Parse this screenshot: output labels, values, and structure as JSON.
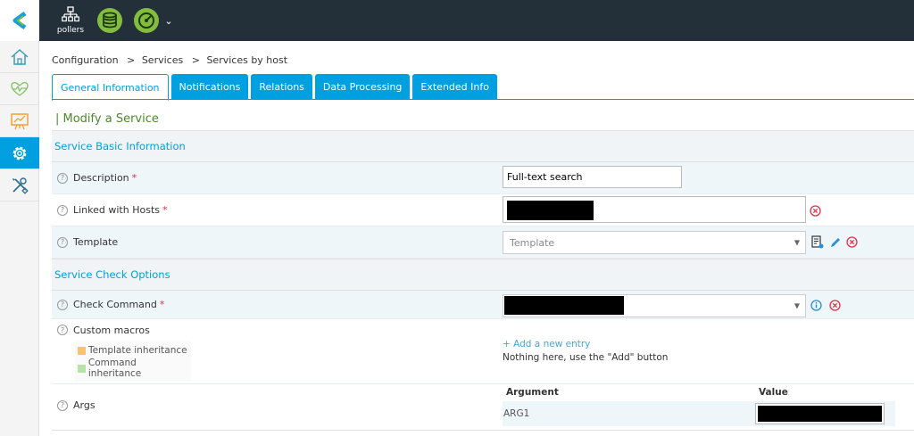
{
  "topbar": {
    "pollers_label": "pollers"
  },
  "breadcrumb": [
    "Configuration",
    ">",
    "Services",
    ">",
    "Services by host"
  ],
  "tabs": [
    {
      "label": "General Information",
      "active": true
    },
    {
      "label": "Notifications",
      "active": false
    },
    {
      "label": "Relations",
      "active": false
    },
    {
      "label": "Data Processing",
      "active": false
    },
    {
      "label": "Extended Info",
      "active": false
    }
  ],
  "page_title": "| Modify a Service",
  "sections": {
    "basic": "Service Basic Information",
    "check": "Service Check Options"
  },
  "fields": {
    "description": {
      "label": "Description",
      "required": "*",
      "value": "Full-text search"
    },
    "linked_hosts": {
      "label": "Linked with Hosts",
      "required": "*"
    },
    "template": {
      "label": "Template",
      "placeholder": "Template"
    },
    "check_command": {
      "label": "Check Command",
      "required": "*"
    },
    "custom_macros": {
      "label": "Custom macros"
    },
    "args": {
      "label": "Args"
    }
  },
  "macros": {
    "legend_template": "Template inheritance",
    "legend_command": "Command inheritance",
    "add_entry": "+ Add a new entry",
    "empty_text": "Nothing here, use the \"Add\" button"
  },
  "args_table": {
    "headers": [
      "Argument",
      "Value"
    ],
    "rows": [
      {
        "argument": "ARG1"
      }
    ]
  },
  "colors": {
    "accent": "#009fdf",
    "topbar": "#232f39",
    "title_green": "#4a8a2a",
    "error_red": "#e0334b",
    "template_inheritance": "#f8c46b",
    "command_inheritance": "#b6e3a6"
  }
}
